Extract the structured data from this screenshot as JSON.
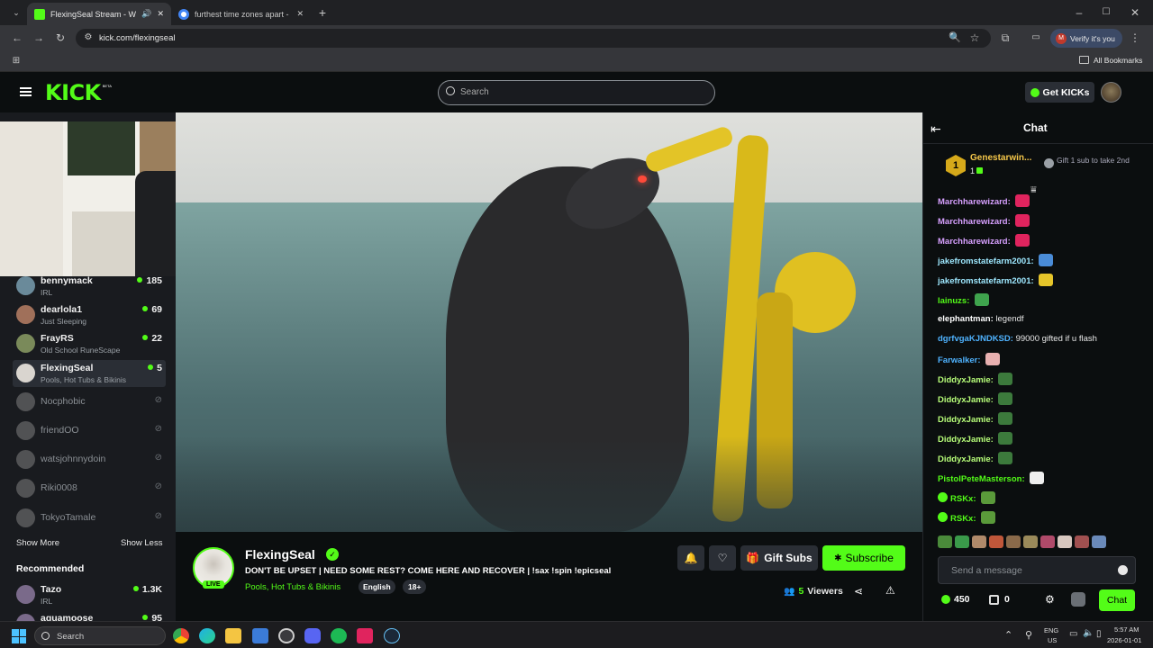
{
  "browser": {
    "tabs": [
      {
        "title": "FlexingSeal Stream - Watch",
        "active": true
      },
      {
        "title": "furthest time zones apart - Goo",
        "active": false
      }
    ],
    "url": "kick.com/flexingseal",
    "profile_label": "Verify it's you",
    "profile_initial": "M",
    "all_bookmarks": "All Bookmarks"
  },
  "header": {
    "logo": "KICK",
    "logo_badge": "BETA",
    "search_placeholder": "Search",
    "get_kicks": "Get KICKs"
  },
  "sidebar": {
    "channels": [
      {
        "name": "bennymack",
        "category": "IRL",
        "viewers": "185",
        "live": true
      },
      {
        "name": "dearlola1",
        "category": "Just Sleeping",
        "viewers": "69",
        "live": true
      },
      {
        "name": "FrayRS",
        "category": "Old School RuneScape",
        "viewers": "22",
        "live": true
      },
      {
        "name": "FlexingSeal",
        "category": "Pools, Hot Tubs & Bikinis",
        "viewers": "5",
        "live": true
      },
      {
        "name": "Nocphobic",
        "live": false
      },
      {
        "name": "friendOO",
        "live": false
      },
      {
        "name": "watsjohnnydoin",
        "live": false
      },
      {
        "name": "Riki0008",
        "live": false
      },
      {
        "name": "TokyoTamale",
        "live": false
      }
    ],
    "show_more": "Show More",
    "show_less": "Show Less",
    "recommended_title": "Recommended",
    "recommended": [
      {
        "name": "Tazo",
        "category": "IRL",
        "viewers": "1.3K"
      },
      {
        "name": "aquamoose",
        "category": "",
        "viewers": "95"
      }
    ]
  },
  "stream": {
    "streamer": "FlexingSeal",
    "live_badge": "LIVE",
    "title": "DON'T BE UPSET | NEED SOME REST? COME HERE AND RECOVER | !sax !spin !epicseal",
    "category": "Pools, Hot Tubs & Bikinis",
    "tags": [
      "English",
      "18+"
    ],
    "gift_subs": "Gift Subs",
    "subscribe": "Subscribe",
    "viewers_count": "5",
    "viewers_label": "Viewers"
  },
  "chat": {
    "title": "Chat",
    "leader": {
      "rank": "1",
      "name": "Genestarwin...",
      "count": "1"
    },
    "gift_promo": "Gift 1 sub to take 2nd",
    "messages": [
      {
        "user": "Marchharewizard:",
        "color": "#d7a0ff",
        "text": "",
        "emote": "#e0245e"
      },
      {
        "user": "Marchharewizard:",
        "color": "#d7a0ff",
        "text": "",
        "emote": "#e0245e"
      },
      {
        "user": "Marchharewizard:",
        "color": "#d7a0ff",
        "text": "",
        "emote": "#e0245e"
      },
      {
        "user": "jakefromstatefarm2001:",
        "color": "#9ee8ff",
        "text": "",
        "emote": "#4a8cd8"
      },
      {
        "user": "jakefromstatefarm2001:",
        "color": "#9ee8ff",
        "text": "",
        "emote": "#e6c52a"
      },
      {
        "user": "lainuzs:",
        "color": "#53fc18",
        "text": "",
        "emote": "#3fa34d"
      },
      {
        "user": "elephantman:",
        "color": "#ffffff",
        "text": "legendf",
        "emote": ""
      },
      {
        "user": "dgrfvgaKJNDKSD:",
        "color": "#4fb3ff",
        "text": "99000 gifted if u flash",
        "emote": ""
      },
      {
        "user": "Farwalker:",
        "color": "#4fb3ff",
        "text": "",
        "emote": "#e8b0b0"
      },
      {
        "user": "DiddyxJamie:",
        "color": "#b8ff7a",
        "text": "",
        "emote": "#3c7a3c"
      },
      {
        "user": "DiddyxJamie:",
        "color": "#b8ff7a",
        "text": "",
        "emote": "#3c7a3c"
      },
      {
        "user": "DiddyxJamie:",
        "color": "#b8ff7a",
        "text": "",
        "emote": "#3c7a3c"
      },
      {
        "user": "DiddyxJamie:",
        "color": "#b8ff7a",
        "text": "",
        "emote": "#3c7a3c"
      },
      {
        "user": "DiddyxJamie:",
        "color": "#b8ff7a",
        "text": "",
        "emote": "#3c7a3c"
      },
      {
        "user": "PistolPeteMasterson:",
        "color": "#53fc18",
        "text": "",
        "emote": "#eeeeee"
      },
      {
        "user": "RSKx:",
        "color": "#53fc18",
        "text": "",
        "emote": "#5a9a3a"
      },
      {
        "user": "RSKx:",
        "color": "#53fc18",
        "text": "",
        "emote": "#5a9a3a"
      }
    ],
    "input_placeholder": "Send a message",
    "points": "450",
    "second_count": "0",
    "chat_button": "Chat"
  },
  "taskbar": {
    "search_placeholder": "Search",
    "lang": "ENG",
    "region": "US",
    "time": "5:57 AM",
    "date": "2026-01-01"
  },
  "colors": {
    "kick_green": "#53fc18",
    "bg": "#0b0e0f",
    "sidebar_bg": "#191b1f"
  }
}
